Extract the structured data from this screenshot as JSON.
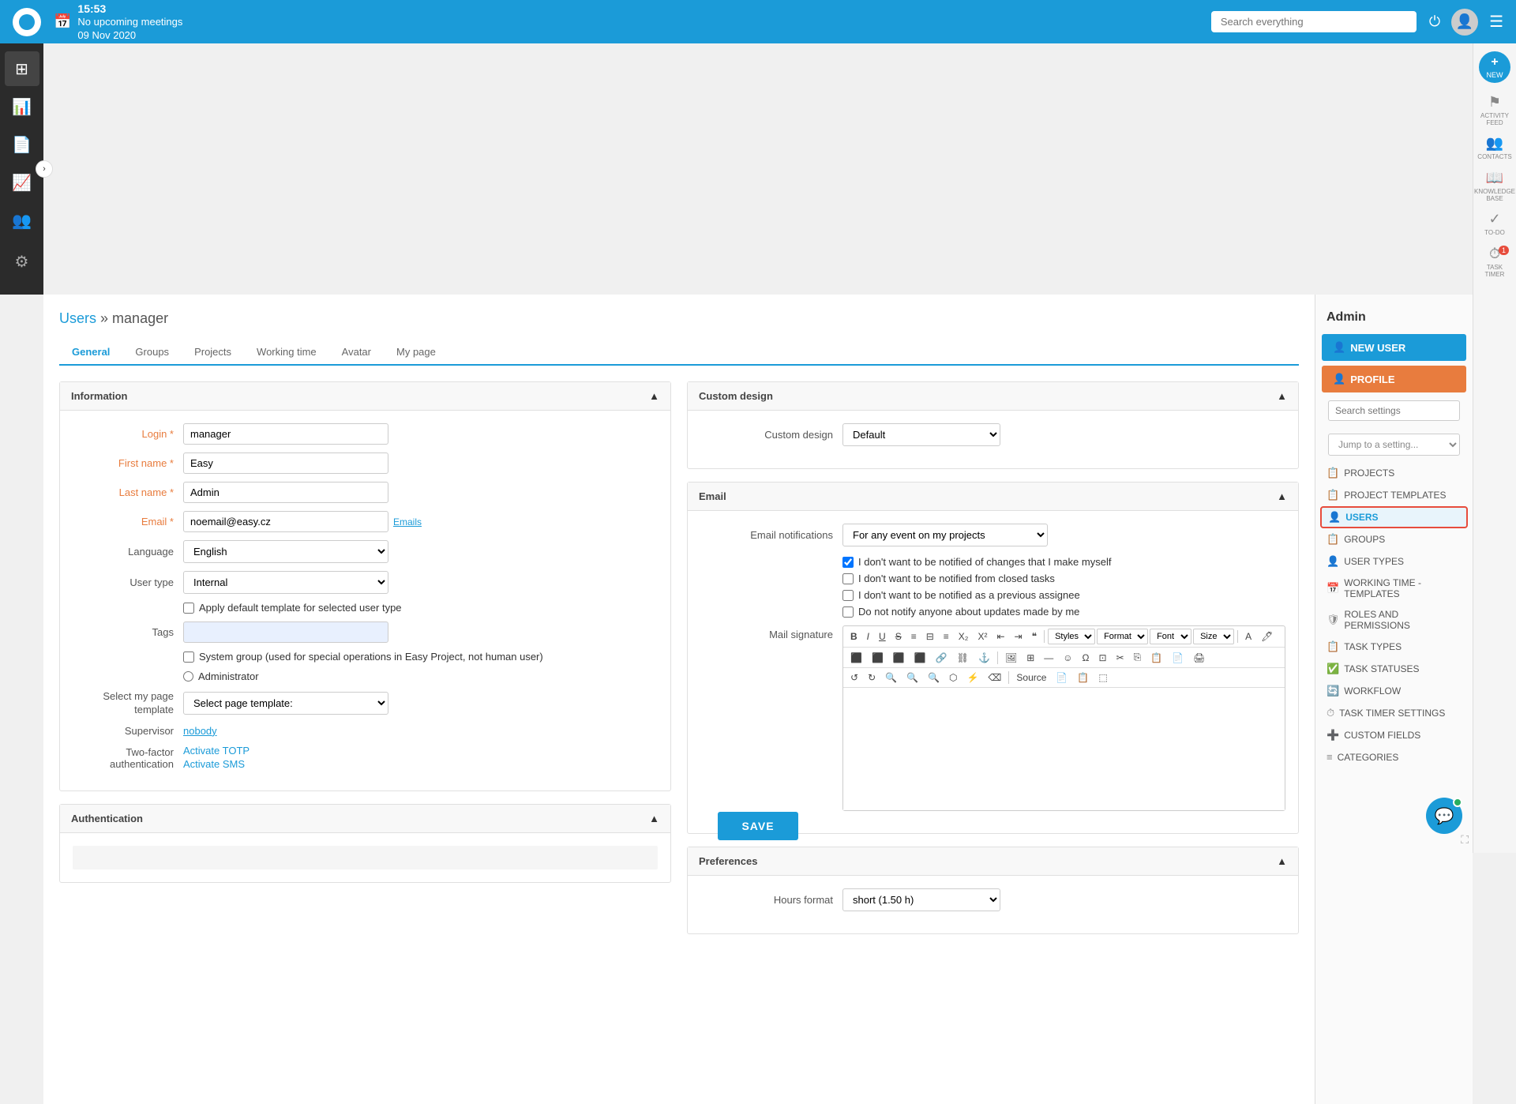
{
  "topbar": {
    "time": "15:53",
    "meeting_label": "No upcoming meetings",
    "date": "09 Nov 2020",
    "search_placeholder": "Search everything"
  },
  "breadcrumb": {
    "parent": "Users",
    "separator": " » ",
    "current": "manager"
  },
  "tabs": [
    {
      "id": "general",
      "label": "General",
      "active": true
    },
    {
      "id": "groups",
      "label": "Groups"
    },
    {
      "id": "projects",
      "label": "Projects"
    },
    {
      "id": "working_time",
      "label": "Working time"
    },
    {
      "id": "avatar",
      "label": "Avatar"
    },
    {
      "id": "my_page",
      "label": "My page"
    }
  ],
  "information_section": {
    "title": "Information",
    "login_label": "Login *",
    "login_value": "manager",
    "firstname_label": "First name *",
    "firstname_value": "Easy",
    "lastname_label": "Last name *",
    "lastname_value": "Admin",
    "email_label": "Email *",
    "email_value": "noemail@easy.cz",
    "email_link": "Emails",
    "language_label": "Language",
    "language_value": "English",
    "usertype_label": "User type",
    "usertype_value": "Internal",
    "apply_template_label": "Apply default template for selected user type",
    "tags_label": "Tags",
    "system_group_label": "System group  (used for special operations in Easy Project, not human user)",
    "administrator_label": "Administrator",
    "select_page_label": "Select my page template",
    "select_page_value": "Select page template:",
    "supervisor_label": "Supervisor",
    "supervisor_value": "nobody",
    "two_factor_label": "Two-factor authentication",
    "activate_totp": "Activate TOTP",
    "activate_sms": "Activate SMS"
  },
  "custom_design_section": {
    "title": "Custom design",
    "custom_design_label": "Custom design",
    "custom_design_value": "Default"
  },
  "email_section": {
    "title": "Email",
    "notifications_label": "Email notifications",
    "notifications_value": "For any event on my projects",
    "check1": "I don't want to be notified of changes that I make myself",
    "check1_checked": true,
    "check2": "I don't want to be notified from closed tasks",
    "check2_checked": false,
    "check3": "I don't want to be notified as a previous assignee",
    "check3_checked": false,
    "check4": "Do not notify anyone about updates made by me",
    "check4_checked": false,
    "mail_signature_label": "Mail signature",
    "toolbar": {
      "bold": "B",
      "italic": "I",
      "underline": "U",
      "strikethrough": "S",
      "styles_label": "Styles",
      "format_label": "Format",
      "font_label": "Font",
      "size_label": "Size",
      "source_label": "Source"
    }
  },
  "preferences_section": {
    "title": "Preferences",
    "hours_format_label": "Hours format",
    "hours_format_value": "short (1.50 h)"
  },
  "authentication_section": {
    "title": "Authentication"
  },
  "admin_panel": {
    "title": "Admin",
    "search_placeholder": "Search settings",
    "jump_placeholder": "Jump to a setting...",
    "new_user_label": "NEW USER",
    "profile_label": "PROFILE",
    "items": [
      {
        "id": "projects",
        "label": "PROJECTS",
        "icon": "📋"
      },
      {
        "id": "project_templates",
        "label": "PROJECT TEMPLATES",
        "icon": "📋"
      },
      {
        "id": "users",
        "label": "USERS",
        "icon": "👤",
        "active": true
      },
      {
        "id": "groups",
        "label": "GROUPS",
        "icon": "📋"
      },
      {
        "id": "user_types",
        "label": "USER TYPES",
        "icon": "👤"
      },
      {
        "id": "working_time",
        "label": "WORKING TIME - TEMPLATES",
        "icon": "📅"
      },
      {
        "id": "roles_permissions",
        "label": "ROLES AND PERMISSIONS",
        "icon": "🛡"
      },
      {
        "id": "task_types",
        "label": "TASK TYPES",
        "icon": "📋"
      },
      {
        "id": "task_statuses",
        "label": "TASK STATUSES",
        "icon": "✅"
      },
      {
        "id": "workflow",
        "label": "WORKFLOW",
        "icon": "🔄"
      },
      {
        "id": "task_timer",
        "label": "TASK TIMER SETTINGS",
        "icon": "⏱"
      },
      {
        "id": "custom_fields",
        "label": "CUSTOM FIELDS",
        "icon": "➕"
      },
      {
        "id": "categories",
        "label": "CATEGORIES",
        "icon": "≡"
      }
    ]
  },
  "right_sidebar": {
    "items": [
      {
        "id": "new",
        "label": "NEW",
        "icon": "+"
      },
      {
        "id": "activity_feed",
        "label": "ACTIVITY FEED",
        "icon": "⚑"
      },
      {
        "id": "contacts",
        "label": "CONTACTS",
        "icon": "👥"
      },
      {
        "id": "knowledge_base",
        "label": "KNOWLEDGE BASE",
        "icon": "📖"
      },
      {
        "id": "to_do",
        "label": "TO-DO",
        "icon": "✓"
      },
      {
        "id": "task_timer",
        "label": "TASK TIMER",
        "icon": "⏱",
        "badge": "1"
      }
    ]
  },
  "save_button_label": "SAVE"
}
